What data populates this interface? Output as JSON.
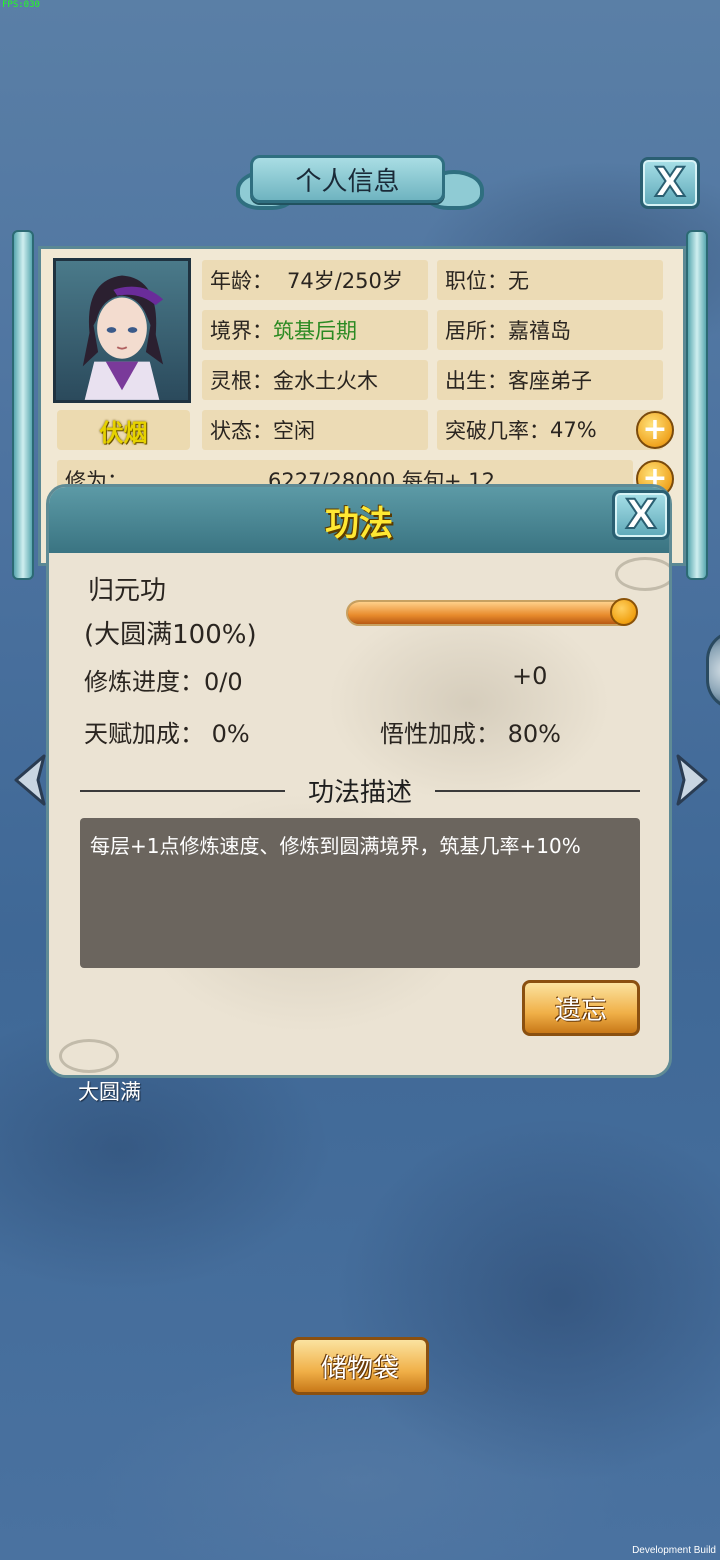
{
  "debug": {
    "fps": "FPS:030",
    "build": "Development Build"
  },
  "header": {
    "title": "个人信息",
    "close_label": "X"
  },
  "character": {
    "name": "伏烟",
    "stats": {
      "age_label": "年龄：",
      "age_value": "74岁/250岁",
      "position_label": "职位：",
      "position_value": "无",
      "realm_label": "境界：",
      "realm_value": "筑基后期",
      "residence_label": "居所：",
      "residence_value": "嘉禧岛",
      "root_label": "灵根：",
      "root_value": "金水土火木",
      "origin_label": "出生：",
      "origin_value": "客座弟子",
      "status_label": "状态：",
      "status_value": "空闲",
      "breakthrough_label": "突破几率：",
      "breakthrough_value": "47%",
      "cultivation_label": "修为：",
      "cultivation_value": "6227/28000  每旬+ 12"
    }
  },
  "popup": {
    "title": "功法",
    "close_label": "X",
    "technique_name": "归元功",
    "technique_level": "(大圆满100%)",
    "progress_fraction": 1.0,
    "training_label": "修炼进度：0/0",
    "training_bonus": "+0",
    "talent_bonus": "天赋加成：  0%",
    "insight_bonus": "悟性加成：  80%",
    "desc_title": "功法描述",
    "description": "每层+1点修炼速度、修炼到圆满境界，筑基几率+10%",
    "forget_label": "遗忘"
  },
  "behind_label": "大圆满",
  "storage_label": "储物袋",
  "colors": {
    "accent_gold": "#ffe833",
    "realm_green": "#2b8a22",
    "panel_teal": "#3a7482"
  }
}
